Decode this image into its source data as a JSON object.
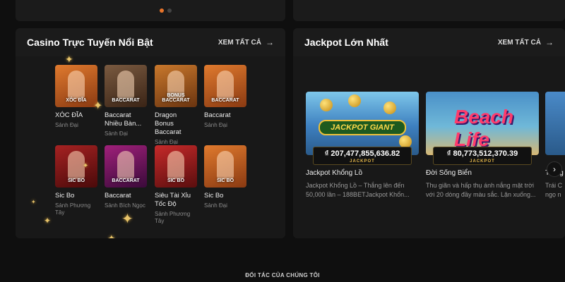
{
  "carousel": {
    "slide_count": 2,
    "active_index": 0
  },
  "casino": {
    "title": "Casino Trực Tuyến Nổi Bật",
    "see_all": "XEM TẤT CẢ",
    "games": [
      {
        "thumb": "XÓC ĐĨA",
        "name": "XÓC ĐĨA",
        "name2": "",
        "sub": "Sảnh Đại",
        "sub2": "",
        "theme": "t-orange"
      },
      {
        "thumb": "BACCARAT",
        "name": "Baccarat",
        "name2": "Nhiều Bàn...",
        "sub": "Sảnh Đại",
        "sub2": "",
        "theme": "t-gold"
      },
      {
        "thumb": "BONUS BACCARAT",
        "name": "Dragon Bonus",
        "name2": "Baccarat",
        "sub": "Sảnh Đại",
        "sub2": "",
        "theme": "t-amber"
      },
      {
        "thumb": "BACCARAT",
        "name": "Baccarat",
        "name2": "",
        "sub": "Sảnh Đại",
        "sub2": "",
        "theme": "t-orange"
      },
      {
        "thumb": "SIC BO",
        "name": "Sic Bo",
        "name2": "",
        "sub": "Sảnh Phương",
        "sub2": "Tây",
        "theme": "t-red"
      },
      {
        "thumb": "BACCARAT",
        "name": "Baccarat",
        "name2": "",
        "sub": "Sảnh Bích Ngọc",
        "sub2": "",
        "theme": "t-purple"
      },
      {
        "thumb": "SIC BO",
        "name": "Siêu Tài Xỉu",
        "name2": "Tốc Độ",
        "sub": "Sảnh Phương",
        "sub2": "Tây",
        "theme": "t-scarlet"
      },
      {
        "thumb": "SIC BO",
        "name": "Sic Bo",
        "name2": "",
        "sub": "Sảnh Đại",
        "sub2": "",
        "theme": "t-orange"
      }
    ]
  },
  "jackpot": {
    "title": "Jackpot Lớn Nhất",
    "see_all": "XEM TẤT CẢ",
    "cards": [
      {
        "logo": "JACKPOT GIANT",
        "amount": "₫ 207,477,855,636.82",
        "amount_label": "JACKPOT",
        "name": "Jackpot Khổng Lồ",
        "desc": "Jackpot Khổng Lồ – Thắng lên đến 50,000 lần – 188BETJackpot Khổn..."
      },
      {
        "logo": "Beach Life",
        "amount": "₫ 80,773,512,370.39",
        "amount_label": "JACKPOT",
        "name": "Đời Sống Biển",
        "desc": "Thu giãn và hấp thụ ánh nắng mặt trời với 20 dòng đầy màu sắc. Lặn xuống..."
      }
    ],
    "partial": {
      "name": "Trang",
      "desc1": "Trái C",
      "desc2": "ngọ n"
    }
  },
  "footer": {
    "partners": "ĐỐI TÁC CỦA CHÚNG TÔI"
  },
  "icons": {
    "arrow_right": "→",
    "chevron_right": "›",
    "sparkle": "✦"
  }
}
